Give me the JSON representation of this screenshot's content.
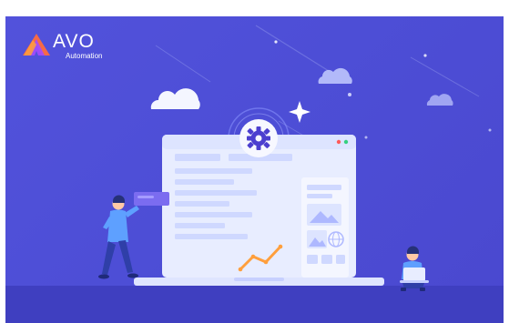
{
  "brand": {
    "name": "AVO",
    "tagline": "Automation"
  },
  "colors": {
    "background": "#4d4ed6",
    "floor": "#3f3fc0",
    "laptop_body": "#e8edff",
    "gear": "#4c3fcf",
    "accent_orange": "#ff9f3d",
    "accent_blue": "#7eaaff"
  },
  "icons": {
    "logo": "avo-logo-icon",
    "settings": "gear-icon",
    "image": "image-placeholder-icon",
    "chart": "line-chart-icon",
    "cloud": "cloud-icon",
    "sparkle": "sparkle-icon"
  }
}
